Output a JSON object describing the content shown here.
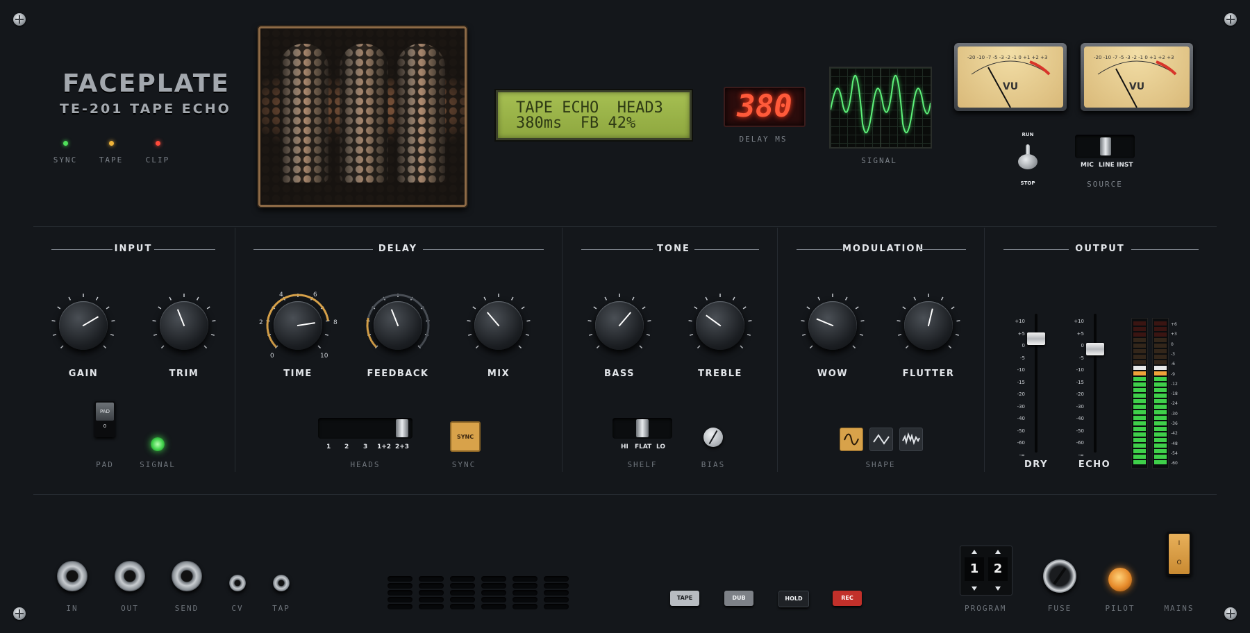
{
  "brand": {
    "name": "FACEPLATE",
    "model": "TE-201 TAPE ECHO"
  },
  "status_leds": [
    {
      "label": "SYNC",
      "color": "#4fe05a"
    },
    {
      "label": "TAPE",
      "color": "#f0b43a"
    },
    {
      "label": "CLIP",
      "color": "#ff4a3a"
    }
  ],
  "lcd": {
    "line1": "TAPE ECHO  HEAD3",
    "line2": "380ms  FB 42%"
  },
  "delay_readout": {
    "value": "380",
    "label": "DELAY MS"
  },
  "scope": {
    "label": "SIGNAL"
  },
  "vu_meters": [
    {
      "scale": "-20 -10 -7 -5 -3 -2 -1 0 +1 +2 +3",
      "label": "VU"
    },
    {
      "scale": "-20 -10 -7 -5 -3 -2 -1 0 +1 +2 +3",
      "label": "VU"
    }
  ],
  "transport": {
    "run": "RUN",
    "stop": "STOP"
  },
  "source": {
    "options": [
      "MIC",
      "LINE",
      "INST"
    ],
    "label": "SOURCE",
    "selected": "LINE"
  },
  "sections": {
    "input": "INPUT",
    "delay": "DELAY",
    "tone": "TONE",
    "modulation": "MODULATION",
    "output": "OUTPUT"
  },
  "knobs": {
    "gain": {
      "label": "GAIN",
      "value": 0.72
    },
    "trim": {
      "label": "TRIM",
      "value": 0.42
    },
    "time": {
      "label": "TIME",
      "value": 0.8,
      "scale": [
        "0",
        "2",
        "4",
        "6",
        "8",
        "10"
      ]
    },
    "feedback": {
      "label": "FEEDBACK",
      "value": 0.42
    },
    "mix": {
      "label": "MIX",
      "value": 0.35
    },
    "bass": {
      "label": "BASS",
      "value": 0.65
    },
    "treble": {
      "label": "TREBLE",
      "value": 0.3
    },
    "wow": {
      "label": "WOW",
      "value": 0.25
    },
    "flutter": {
      "label": "FLUTTER",
      "value": 0.55
    }
  },
  "pad": {
    "cap": "PAD",
    "zero": "0",
    "label": "PAD"
  },
  "signal": {
    "label": "SIGNAL"
  },
  "heads": {
    "options": [
      "1",
      "2",
      "3",
      "1+2",
      "2+3"
    ],
    "label": "HEADS",
    "selected": "2+3"
  },
  "sync": {
    "button": "SYNC",
    "label": "SYNC"
  },
  "shelf": {
    "options": [
      "HI",
      "FLAT",
      "LO"
    ],
    "label": "SHELF",
    "selected": "FLAT"
  },
  "bias": {
    "label": "BIAS"
  },
  "shape": {
    "label": "SHAPE",
    "options": [
      "sine",
      "triangle",
      "random"
    ],
    "selected": "sine"
  },
  "faders": {
    "scale": [
      "+10",
      "+5",
      "0",
      "-5",
      "-10",
      "-15",
      "-20",
      "-30",
      "-40",
      "-50",
      "-60",
      "-∞"
    ],
    "dry": {
      "label": "DRY",
      "value_db": "+2"
    },
    "echo": {
      "label": "ECHO",
      "value_db": "0"
    }
  },
  "meter_scale": [
    "+6",
    "+3",
    "0",
    "-3",
    "-6",
    "-9",
    "-12",
    "-18",
    "-24",
    "-30",
    "-36",
    "-42",
    "-48",
    "-54",
    "-60"
  ],
  "jacks": [
    {
      "label": "IN"
    },
    {
      "label": "OUT"
    },
    {
      "label": "SEND"
    },
    {
      "label": "CV"
    },
    {
      "label": "TAP"
    }
  ],
  "switch_buttons": [
    {
      "label": "TAPE",
      "color": "#b8bcc1"
    },
    {
      "label": "DUB",
      "color": "#7d8187"
    },
    {
      "label": "HOLD",
      "color": "#1f2226"
    },
    {
      "label": "REC",
      "color": "#c2302a"
    }
  ],
  "program": {
    "digits": [
      "1",
      "2"
    ],
    "label": "PROGRAM"
  },
  "fuse": {
    "label": "FUSE"
  },
  "pilot": {
    "label": "PILOT"
  },
  "mains": {
    "on": "I",
    "off": "O",
    "label": "MAINS"
  }
}
